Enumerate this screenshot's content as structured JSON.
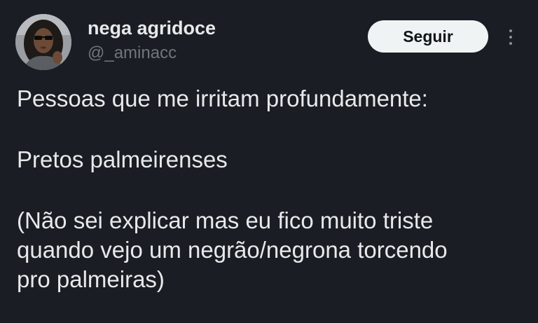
{
  "author": {
    "display_name": "nega agridoce",
    "handle": "@_aminacc"
  },
  "follow_button_label": "Seguir",
  "more_icon": "more-vertical-icon",
  "tweet": {
    "line1": "Pessoas que me irritam profundamente:",
    "line2": "Pretos palmeirenses",
    "line3a": "(Não sei explicar mas eu fico muito triste",
    "line3b": "quando vejo um negrão/negrona torcendo",
    "line3c": "pro palmeiras)"
  },
  "colors": {
    "background": "#1a1d24",
    "primary_text": "#e7e9ea",
    "secondary_text": "#71767b",
    "button_bg": "#eff3f4",
    "button_text": "#0f1419"
  }
}
